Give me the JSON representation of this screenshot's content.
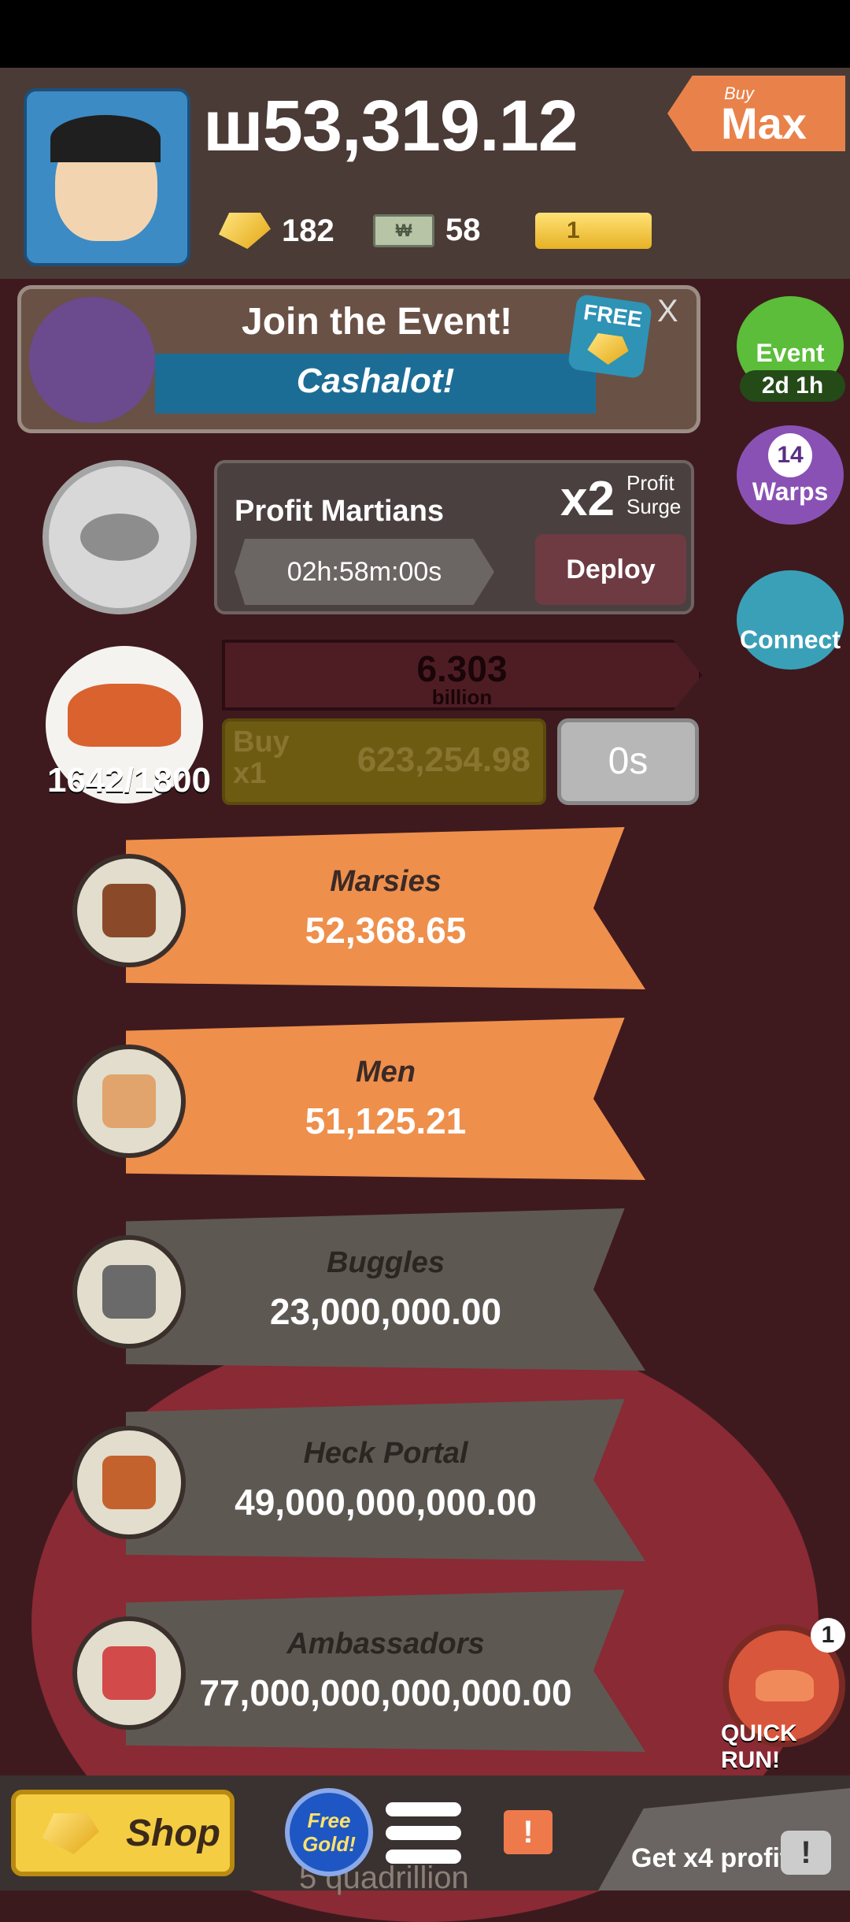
{
  "header": {
    "money": "ш53,319.12",
    "gold": "182",
    "bills": "58",
    "bill_icon_text": "₩",
    "tickets": "1",
    "buy_max_small": "Buy",
    "buy_max_big": "Max"
  },
  "event_banner": {
    "title": "Join the Event!",
    "subtitle": "Cashalot!",
    "badge": "FREE",
    "close": "X"
  },
  "side_buttons": {
    "event_label": "Event",
    "event_timer": "2d 1h",
    "warps_count": "14",
    "warps_label": "Warps",
    "connect_label": "Connect"
  },
  "profit_martians": {
    "title": "Profit Martians",
    "multiplier": "x2",
    "surge_line1": "Profit",
    "surge_line2": "Surge",
    "timer": "02h:58m:00s",
    "deploy_label": "Deploy"
  },
  "resource": {
    "count": "1642/1800",
    "progress_value": "6.303",
    "progress_unit": "billion",
    "buy_label_1": "Buy",
    "buy_label_2": "x1",
    "buy_cost": "623,254.98",
    "timer": "0s"
  },
  "managers": [
    {
      "name": "Marsies",
      "value": "52,368.65",
      "state": "active",
      "icon": "chocolate-bar-icon",
      "color": "#8a4a2a"
    },
    {
      "name": "Men",
      "value": "51,125.21",
      "state": "active",
      "icon": "man-face-icon",
      "color": "#e0a46c"
    },
    {
      "name": "Buggles",
      "value": "23,000,000.00",
      "state": "locked",
      "icon": "skull-icon",
      "color": "#6a6a6a"
    },
    {
      "name": "Heck Portal",
      "value": "49,000,000,000.00",
      "state": "locked",
      "icon": "portal-icon",
      "color": "#c4622e"
    },
    {
      "name": "Ambassadors",
      "value": "77,000,000,000,000.00",
      "state": "locked",
      "icon": "ambassador-icon",
      "color": "#d24a4a"
    }
  ],
  "quick_run": {
    "badge": "1",
    "label": "QUICK RUN!"
  },
  "bottom_bar": {
    "shop_label": "Shop",
    "free_gold_line1": "Free",
    "free_gold_line2": "Gold!",
    "alert": "!",
    "ticker": "5 quadrillion",
    "x4_label": "Get x4 profit!",
    "tv_mark": "!"
  },
  "colors": {
    "accent_orange": "#ee8f4c",
    "locked_gray": "#5e5853",
    "background": "#3e1a1f"
  }
}
